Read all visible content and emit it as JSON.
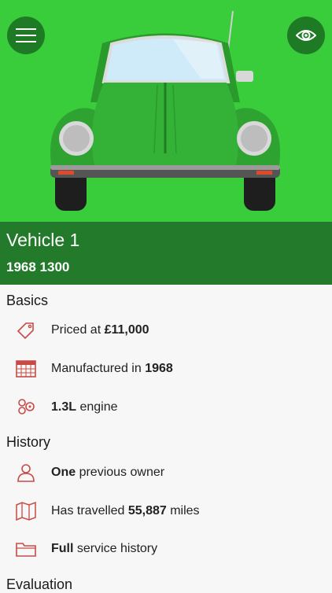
{
  "hero": {
    "menu_icon": "hamburger-icon",
    "eye_icon": "eye-icon",
    "accent_color": "#39cc3b",
    "band_color": "#237a2a"
  },
  "vehicle": {
    "name": "Vehicle 1",
    "subtitle": "1968 1300"
  },
  "sections": {
    "basics": {
      "title": "Basics",
      "items": [
        {
          "icon": "price-tag-icon",
          "pre": "Priced at ",
          "bold": "£11,000",
          "post": ""
        },
        {
          "icon": "calendar-icon",
          "pre": "Manufactured in ",
          "bold": "1968",
          "post": ""
        },
        {
          "icon": "engine-icon",
          "pre": "",
          "bold": "1.3L",
          "post": " engine"
        }
      ]
    },
    "history": {
      "title": "History",
      "items": [
        {
          "icon": "person-icon",
          "pre": "",
          "bold": "One",
          "post": " previous owner"
        },
        {
          "icon": "map-icon",
          "pre": "Has travelled ",
          "bold": "55,887",
          "post": " miles"
        },
        {
          "icon": "folder-icon",
          "pre": "",
          "bold": "Full",
          "post": " service history"
        }
      ]
    },
    "evaluation": {
      "title": "Evaluation"
    }
  }
}
